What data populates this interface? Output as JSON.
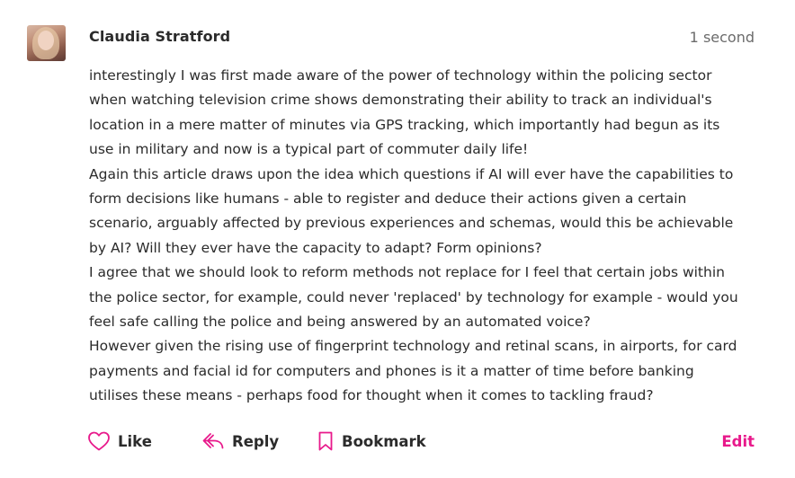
{
  "comment": {
    "author": "Claudia Stratford",
    "time": "1 second",
    "paragraphs": [
      "interestingly I was first made aware of the power of technology within the policing sector",
      "when watching television crime shows demonstrating their ability to track an individual's",
      "location in a mere matter of minutes via GPS tracking, which importantly had begun as its",
      "use in military and now is a typical part of commuter daily life!",
      "Again this article draws upon the idea which questions if AI will ever have the capabilities to",
      "form decisions like humans - able to register and deduce their actions given a certain",
      "scenario, arguably affected by previous experiences and schemas, would this be achievable",
      "by AI? Will they ever have the capacity to adapt? Form opinions?",
      "I agree that we should look to reform methods not replace for I feel that certain jobs within",
      "the police sector, for example, could never 'replaced' by technology for example - would you",
      "feel safe calling the police and being answered by an automated voice?",
      "However given the rising use of fingerprint technology and retinal scans, in airports, for card",
      "payments and facial id for computers and phones is it a matter of time before banking",
      "utilises these means - perhaps food for thought when it comes to tackling fraud?"
    ]
  },
  "actions": {
    "like_label": "Like",
    "reply_label": "Reply",
    "bookmark_label": "Bookmark",
    "edit_label": "Edit"
  },
  "icons": {
    "like": "heart-outline-icon",
    "reply": "reply-arrow-icon",
    "bookmark": "bookmark-outline-icon"
  },
  "colors": {
    "accent": "#e8198b",
    "text": "#2b2b2b",
    "muted": "#6b6b6b"
  }
}
